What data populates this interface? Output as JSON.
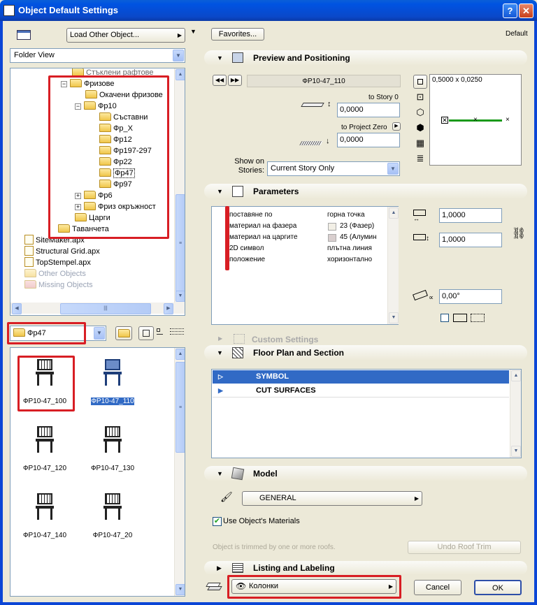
{
  "window": {
    "title": "Object Default Settings",
    "help_btn": "?",
    "close_btn": "✕"
  },
  "left": {
    "load_other": "Load Other Object...",
    "view_mode": "Folder View",
    "tree": [
      {
        "label": "Стъклени рафтове"
      },
      {
        "label": "Фризове",
        "exp": "−"
      },
      {
        "label": "Окачени фризове"
      },
      {
        "label": "Фр10",
        "exp": "−"
      },
      {
        "label": "Съставни"
      },
      {
        "label": "Фр_X"
      },
      {
        "label": "Фр12"
      },
      {
        "label": "Фр197-297"
      },
      {
        "label": "Фр22"
      },
      {
        "label": "Фр47"
      },
      {
        "label": "Фр97"
      },
      {
        "label": "Фр6",
        "exp": "+"
      },
      {
        "label": "Фриз окръжност",
        "exp": "+"
      },
      {
        "label": "Царги"
      },
      {
        "label": "Таванчета"
      },
      {
        "label": "SiteMaker.apx"
      },
      {
        "label": "Structural Grid.apx"
      },
      {
        "label": "TopStempel.apx"
      },
      {
        "label": "Other Objects"
      },
      {
        "label": "Missing Objects"
      }
    ],
    "current_folder": "Фр47",
    "objects": [
      "ФР10-47_100",
      "ФР10-47_110",
      "ФР10-47_120",
      "ФР10-47_130",
      "ФР10-47_140",
      "ФР10-47_20"
    ]
  },
  "right": {
    "favorites": "Favorites...",
    "default_label": "Default",
    "preview": {
      "section_title": "Preview and Positioning",
      "object_name": "ФР10-47_110",
      "to_story_label": "to Story 0",
      "to_story_value": "0,0000",
      "to_project_zero_label": "to Project Zero",
      "project_zero_value": "0,0000",
      "show_on_stories_label": "Show on Stories:",
      "show_on_stories_value": "Current Story Only",
      "size_readout": "0,5000 x 0,0250"
    },
    "parameters": {
      "section_title": "Parameters",
      "rows": [
        {
          "name": "поставяне по",
          "value": "горна точка"
        },
        {
          "name": "материал на фазера",
          "value": "23 (Фазер)"
        },
        {
          "name": "материал на царгите",
          "value": "45 (Алумин"
        },
        {
          "name": "2D символ",
          "value": "плътна линия"
        },
        {
          "name": "положение",
          "value": "хоризонтално"
        }
      ],
      "width_value": "1,0000",
      "depth_value": "1,0000",
      "angle_value": "0,00°"
    },
    "custom_settings": "Custom Settings",
    "floor_plan": {
      "section_title": "Floor Plan and Section",
      "items": [
        "SYMBOL",
        "CUT SURFACES"
      ]
    },
    "model": {
      "section_title": "Model",
      "dropdown": "GENERAL",
      "use_materials": "Use Object's Materials",
      "trim_note": "Object is trimmed by one or more roofs.",
      "undo_trim": "Undo Roof Trim"
    },
    "listing": {
      "section_title": "Listing and Labeling"
    },
    "layer": "Колонки",
    "cancel": "Cancel",
    "ok": "OK"
  },
  "colors": {
    "title_blue": "#0a48c9",
    "selection": "#316ac5",
    "highlight_red": "#d81e24",
    "line_green": "#1a9a1a"
  }
}
